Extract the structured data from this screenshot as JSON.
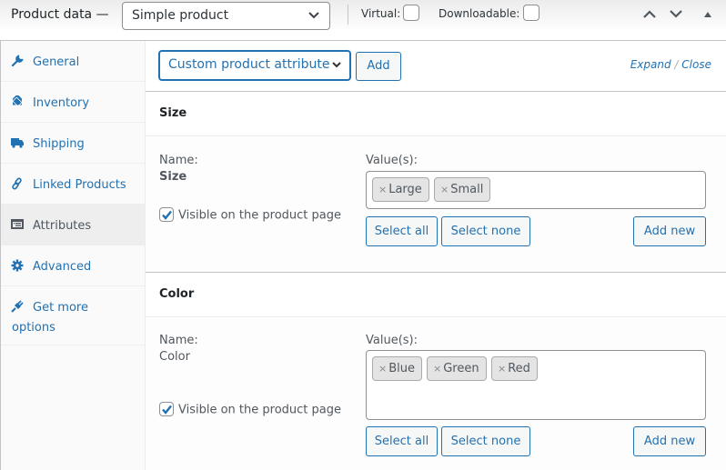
{
  "header": {
    "title": "Product data —",
    "product_type": "Simple product",
    "virtual_label": "Virtual:",
    "virtual_checked": false,
    "downloadable_label": "Downloadable:",
    "downloadable_checked": false
  },
  "sidebar": {
    "items": [
      {
        "label": "General",
        "icon": "wrench-icon",
        "active": false
      },
      {
        "label": "Inventory",
        "icon": "tag-icon",
        "active": false
      },
      {
        "label": "Shipping",
        "icon": "truck-icon",
        "active": false
      },
      {
        "label": "Linked Products",
        "icon": "link-icon",
        "active": false
      },
      {
        "label": "Attributes",
        "icon": "list-card-icon",
        "active": true
      },
      {
        "label": "Advanced",
        "icon": "gear-icon",
        "active": false
      },
      {
        "label": "Get more options",
        "icon": "plug-icon",
        "active": false
      }
    ]
  },
  "toolbar": {
    "attribute_select": "Custom product attribute",
    "add_label": "Add",
    "expand_label": "Expand",
    "separator": "/",
    "close_label": "Close"
  },
  "attributes": [
    {
      "title": "Size",
      "name_label": "Name:",
      "name": "Size",
      "visible_label": "Visible on the product page",
      "visible_checked": true,
      "values_label": "Value(s):",
      "values": [
        "Large",
        "Small"
      ],
      "select_all": "Select all",
      "select_none": "Select none",
      "add_new": "Add new"
    },
    {
      "title": "Color",
      "name_label": "Name:",
      "name": "Color",
      "visible_label": "Visible on the product page",
      "visible_checked": true,
      "values_label": "Value(s):",
      "values": [
        "Blue",
        "Green",
        "Red"
      ],
      "select_all": "Select all",
      "select_none": "Select none",
      "add_new": "Add new"
    }
  ],
  "chip_remove_glyph": "×",
  "colors": {
    "accent": "#2271b1",
    "text": "#50575e",
    "border": "#c3c4c7"
  }
}
